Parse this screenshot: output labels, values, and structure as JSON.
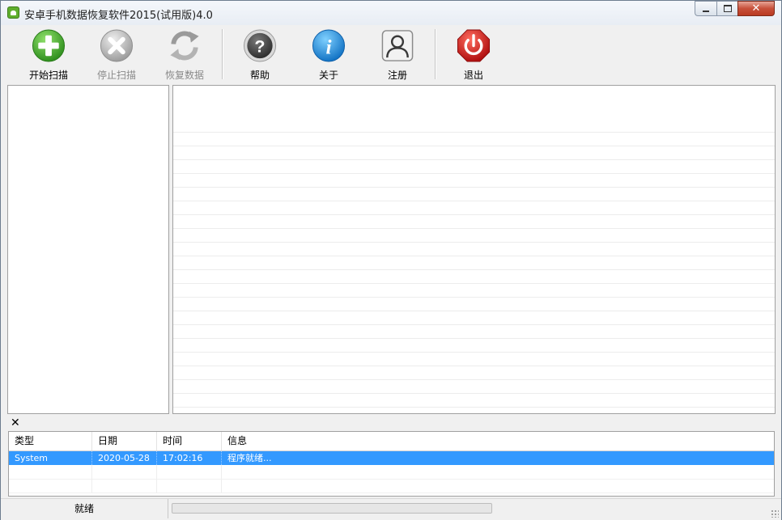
{
  "window": {
    "title": "安卓手机数据恢复软件2015(试用版)4.0",
    "close_glyph": "✕"
  },
  "toolbar": {
    "buttons": [
      {
        "label": "开始扫描",
        "icon": "plus-circle-icon",
        "enabled": true,
        "color": "#4caf35"
      },
      {
        "label": "停止扫描",
        "icon": "x-circle-icon",
        "enabled": false,
        "color": "#b9b9b9"
      },
      {
        "label": "恢复数据",
        "icon": "refresh-icon",
        "enabled": false,
        "color": "#a0a0a0"
      },
      {
        "label": "帮助",
        "icon": "question-icon",
        "enabled": true,
        "color": "#4a4a4a"
      },
      {
        "label": "关于",
        "icon": "info-icon",
        "enabled": true,
        "color": "#1e8fdc"
      },
      {
        "label": "注册",
        "icon": "user-icon",
        "enabled": true,
        "color": "#555555"
      },
      {
        "label": "退出",
        "icon": "power-icon",
        "enabled": true,
        "color": "#d42020"
      }
    ]
  },
  "log": {
    "close_glyph": "✕",
    "columns": [
      "类型",
      "日期",
      "时间",
      "信息"
    ],
    "rows": [
      {
        "type": "System",
        "date": "2020-05-28",
        "time": "17:02:16",
        "info": "程序就绪..."
      }
    ],
    "selected_color": "#3399ff"
  },
  "status": {
    "text": "就绪",
    "progress": 0
  }
}
